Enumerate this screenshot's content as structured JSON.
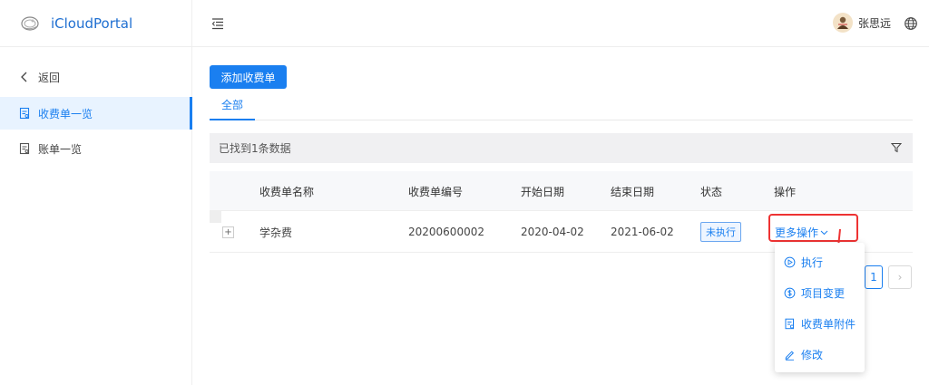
{
  "app": {
    "title": "iCloudPortal"
  },
  "sidebar": {
    "items": [
      {
        "label": "返回"
      },
      {
        "label": "收费单一览"
      },
      {
        "label": "账单一览"
      }
    ]
  },
  "header": {
    "user_name": "张思远"
  },
  "toolbar": {
    "add_label": "添加收费单"
  },
  "tabs": [
    {
      "label": "全部"
    }
  ],
  "filter": {
    "result_text": "已找到1条数据"
  },
  "table": {
    "columns": [
      "收费单名称",
      "收费单编号",
      "开始日期",
      "结束日期",
      "状态",
      "操作"
    ],
    "rows": [
      {
        "expand": "+",
        "name": "学杂费",
        "number": "20200600002",
        "start": "2020-04-02",
        "end": "2021-06-02",
        "status": "未执行",
        "action": "更多操作"
      }
    ]
  },
  "dropdown": {
    "items": [
      {
        "label": "执行",
        "icon": "play-circle-icon"
      },
      {
        "label": "项目变更",
        "icon": "dollar-circle-icon"
      },
      {
        "label": "收费单附件",
        "icon": "document-icon"
      },
      {
        "label": "修改",
        "icon": "edit-icon"
      }
    ]
  },
  "pagination": {
    "current": "1",
    "next": "›"
  },
  "colors": {
    "primary": "#1a7ff0",
    "highlight": "#e33333",
    "sidebar_active_bg": "#e8f3ff"
  }
}
